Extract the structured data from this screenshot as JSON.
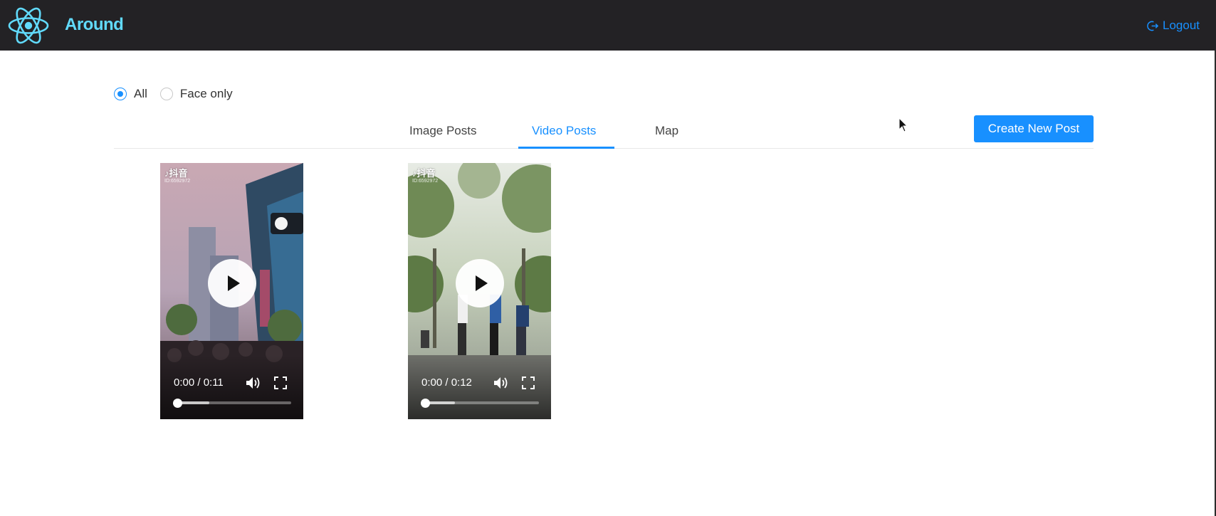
{
  "header": {
    "app_title": "Around",
    "logout_label": "Logout",
    "brand_color": "#61dafb",
    "logout_color": "#1890ff"
  },
  "filter": {
    "options": [
      {
        "label": "All",
        "selected": true
      },
      {
        "label": "Face only",
        "selected": false
      }
    ]
  },
  "tabs": [
    {
      "label": "Image Posts",
      "active": false
    },
    {
      "label": "Video Posts",
      "active": true
    },
    {
      "label": "Map",
      "active": false
    }
  ],
  "create_button_label": "Create New Post",
  "videos": [
    {
      "watermark": "♪抖音",
      "watermark_id": "ID:6592972",
      "time": "0:00 / 0:11",
      "progress": 0.02,
      "buffered": 0.28
    },
    {
      "watermark": "♪抖音",
      "watermark_id": "ID:6592972",
      "time": "0:00 / 0:12",
      "progress": 0.02,
      "buffered": 0.26
    }
  ],
  "icons": {
    "logo": "react-atom-icon",
    "logout": "logout-icon",
    "play": "play-icon",
    "volume": "volume-icon",
    "fullscreen": "fullscreen-icon",
    "cursor": "mouse-cursor-icon"
  },
  "accent_color": "#1890ff"
}
